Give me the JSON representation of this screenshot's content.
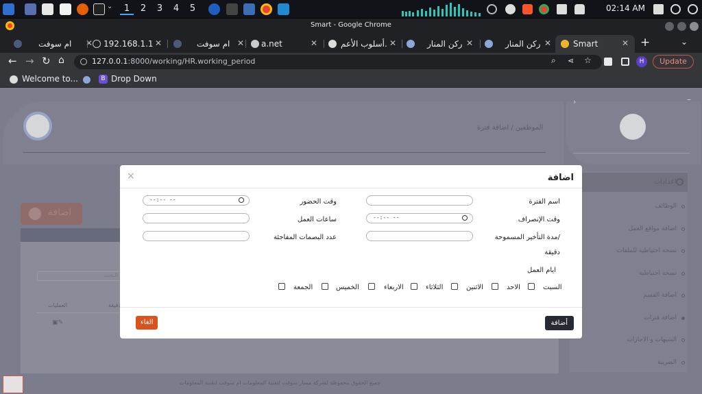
{
  "taskbar": {
    "workspaces": [
      "1",
      "2",
      "3",
      "4",
      "5"
    ],
    "clock": "02:14 AM"
  },
  "chrome": {
    "window_title": "Smart - Google Chrome",
    "tabs": [
      {
        "label": "ام سوفت"
      },
      {
        "label": "192.168.1.1"
      },
      {
        "label": "ام سوفت"
      },
      {
        "label": "a.net"
      },
      {
        "label": "أسلوب الأعم."
      },
      {
        "label": "ركن المنار"
      },
      {
        "label": "ركن المنار"
      },
      {
        "label": "Smart"
      }
    ],
    "url_host": "127.0.0.1",
    "url_rest": ":8000/working/HR.working_period",
    "profile_initial": "H",
    "update_label": "Update",
    "bookmarks": [
      "Welcome to...",
      "Drop Down"
    ],
    "bookmark_badge": "B"
  },
  "page": {
    "breadcrumb": "الموظفين / اضافة فترة",
    "add_button": "اضافة",
    "search_placeholder": "البحث",
    "col_actions": "العمليات",
    "col_minute": "دقيقة",
    "footer": "جميع الحقوق محفوظة لشركة مسار سوفت لتقنية المعلومات ام سوفت لتقنية المعلومات",
    "sidebar": [
      "اعدادات",
      "الوظائف",
      "اضافة مواقع العمل",
      "نسخة احتياطية للملفات",
      "نسخة احتياطية",
      "اضافة القسم",
      "اضافة فترات",
      "الشبهات و الاجازات",
      "الضريبة"
    ]
  },
  "modal": {
    "title": "اضافة",
    "close": "×",
    "labels": {
      "period_name": "اسم الفترة",
      "checkin_time": "وقت الحضور",
      "checkout_time": "وقت الإنصراف",
      "work_hours": "ساعات العمل",
      "allowed_delay": "مدة التأخير المسموحة/",
      "minute": "دقيقة",
      "surprise_prints": "عدد البصمات المفاجئة",
      "work_days": "ايام العمل"
    },
    "time_placeholder": "--:-- --",
    "days": [
      "السبت",
      "الاحد",
      "الاثنين",
      "الثلاثاء",
      "الاربعاء",
      "الخميس",
      "الجمعة"
    ],
    "submit": "أضافة",
    "cancel": "الغاء"
  }
}
